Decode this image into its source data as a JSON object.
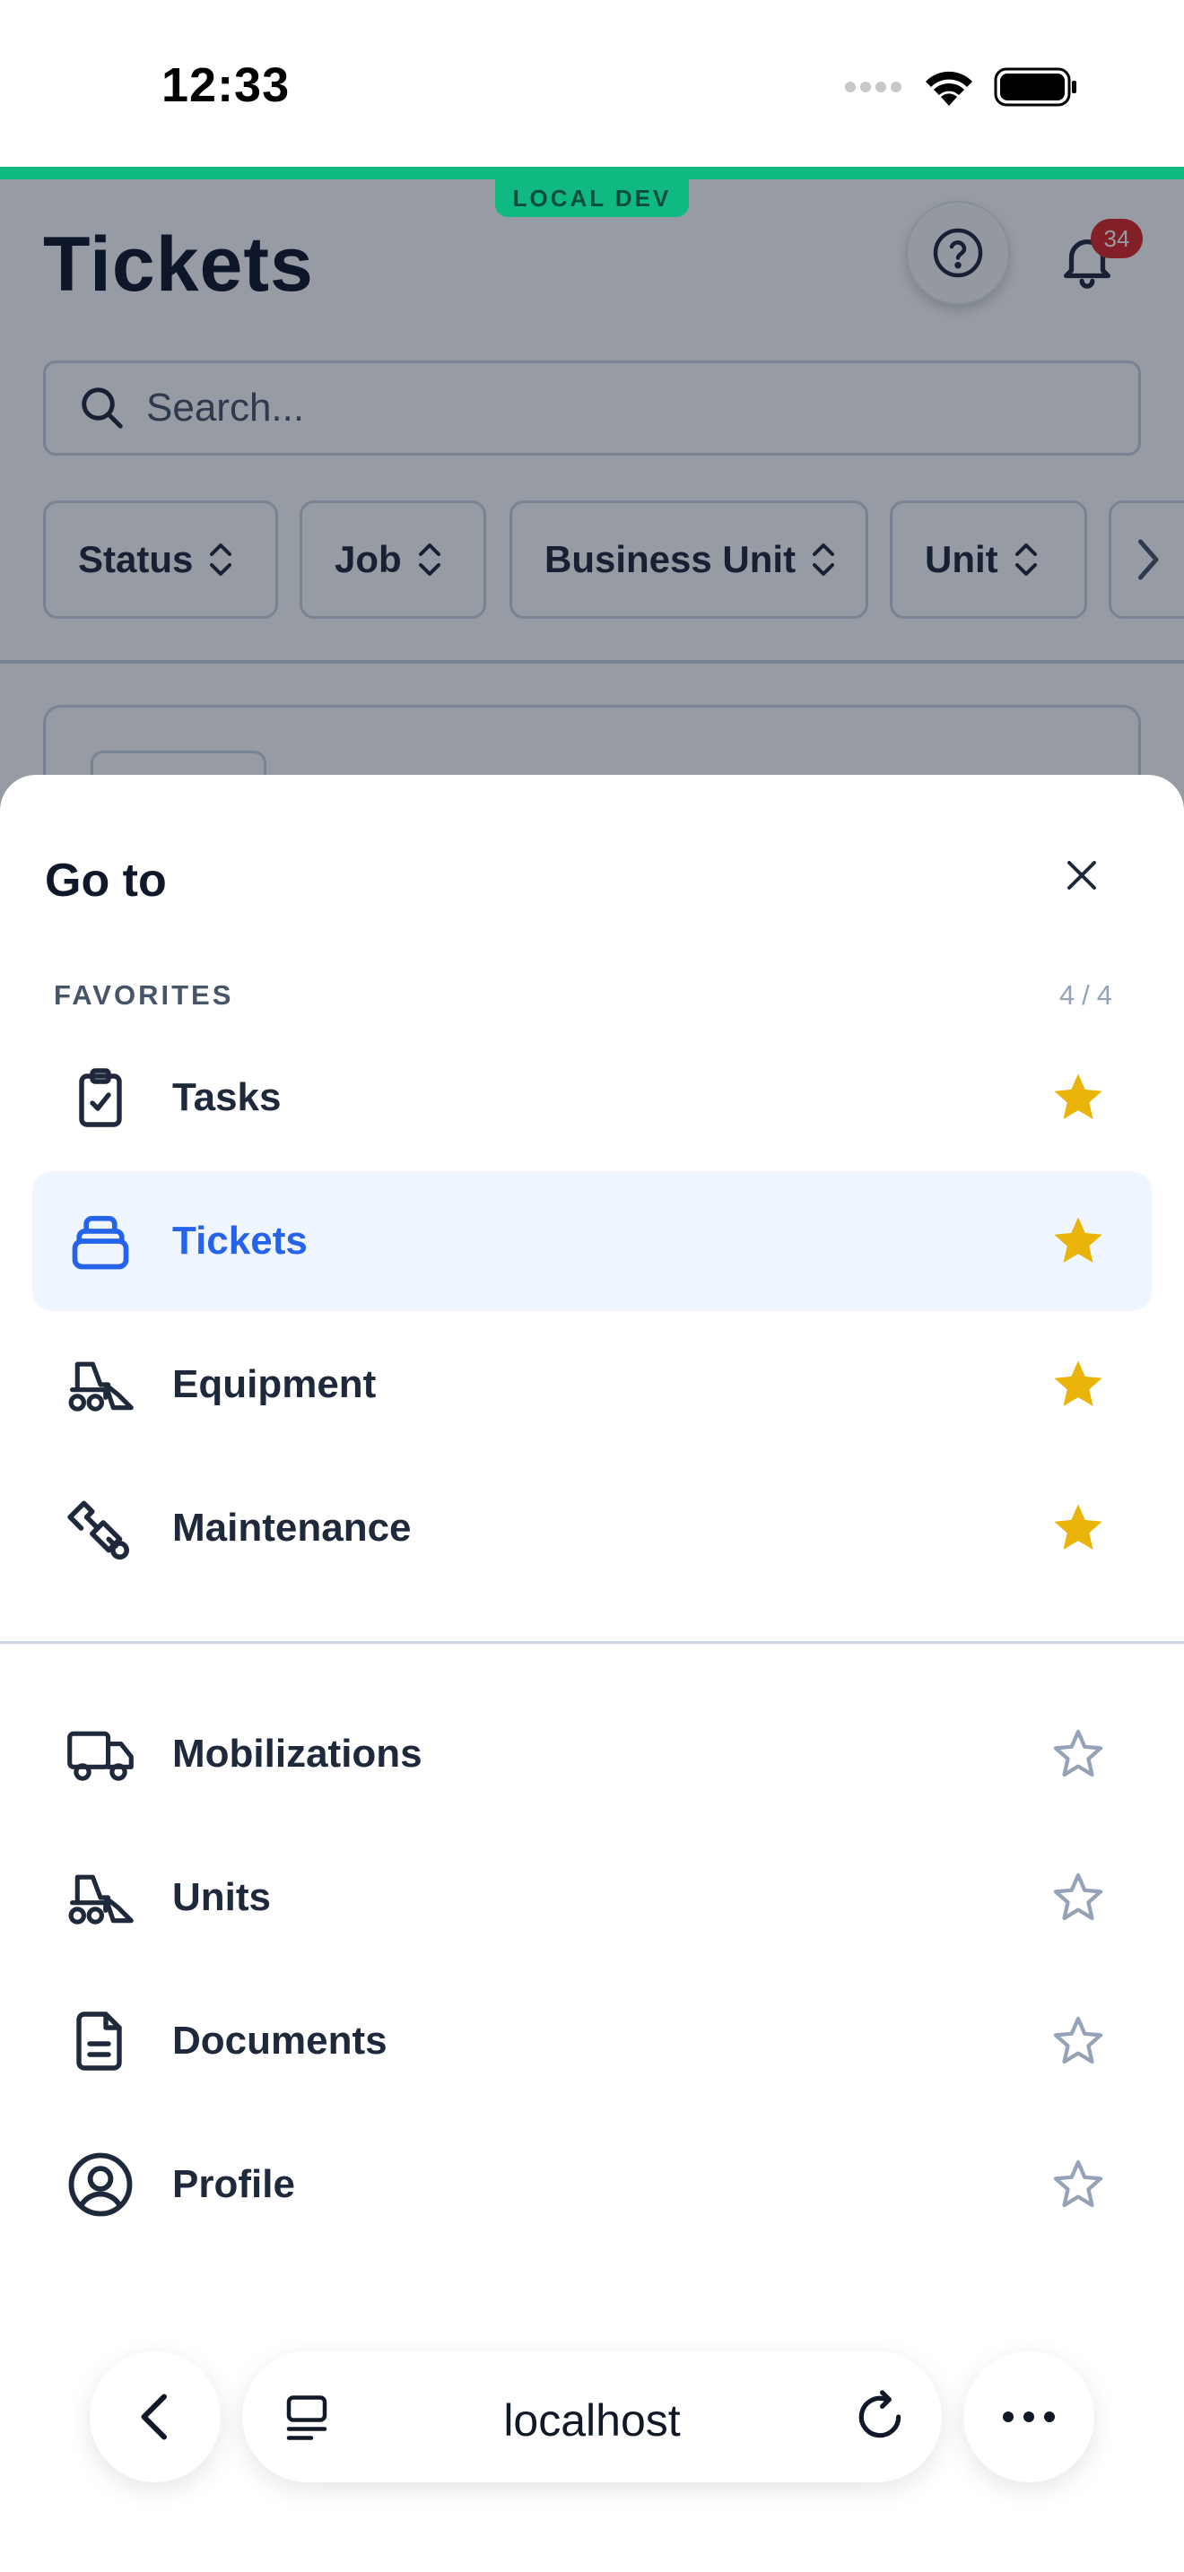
{
  "status_bar": {
    "time": "12:33"
  },
  "environment": {
    "badge": "LOCAL DEV",
    "accent_color": "#10b981"
  },
  "page": {
    "title": "Tickets",
    "notification_count": "34",
    "search": {
      "placeholder": "Search...",
      "value": ""
    },
    "filters": [
      {
        "label": "Status"
      },
      {
        "label": "Job"
      },
      {
        "label": "Business Unit"
      },
      {
        "label": "Unit"
      }
    ]
  },
  "sheet": {
    "title": "Go to",
    "favorites_header": "FAVORITES",
    "favorites_count": {
      "current": "4",
      "separator": "/",
      "max": "4"
    },
    "favorites": [
      {
        "label": "Tasks",
        "icon": "clipboard-check-icon",
        "starred": true
      },
      {
        "label": "Tickets",
        "icon": "ticket-stack-icon",
        "starred": true,
        "active": true
      },
      {
        "label": "Equipment",
        "icon": "skid-steer-icon",
        "starred": true
      },
      {
        "label": "Maintenance",
        "icon": "wrench-icon",
        "starred": true
      }
    ],
    "others": [
      {
        "label": "Mobilizations",
        "icon": "truck-icon",
        "starred": false
      },
      {
        "label": "Units",
        "icon": "skid-steer-icon",
        "starred": false
      },
      {
        "label": "Documents",
        "icon": "document-icon",
        "starred": false
      },
      {
        "label": "Profile",
        "icon": "user-circle-icon",
        "starred": false
      }
    ]
  },
  "browser": {
    "url": "localhost"
  },
  "colors": {
    "active_text": "#2563eb",
    "active_bg": "#eff6ff",
    "star_filled": "#eab308",
    "star_empty": "#94a3b8",
    "badge_red": "#dc2626"
  }
}
